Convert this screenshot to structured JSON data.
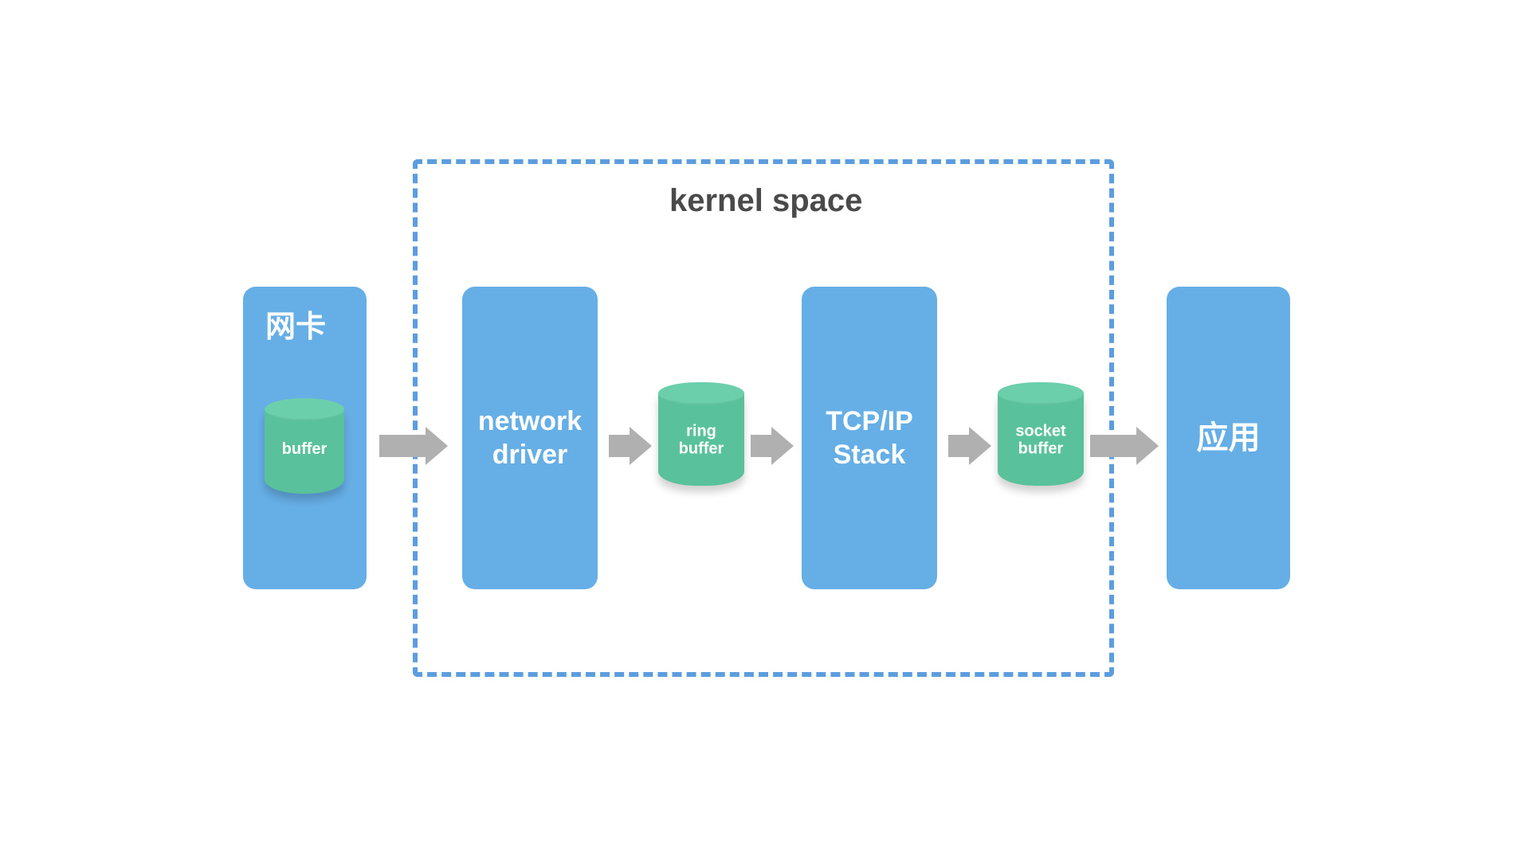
{
  "kernel_space_title": "kernel space",
  "nic": {
    "title": "网卡",
    "buffer_label": "buffer"
  },
  "network_driver": {
    "line1": "network",
    "line2": "driver"
  },
  "ring_buffer": {
    "line1": "ring",
    "line2": "buffer"
  },
  "tcpip_stack": {
    "line1": "TCP/IP",
    "line2": "Stack"
  },
  "socket_buffer": {
    "line1": "socket",
    "line2": "buffer"
  },
  "app": {
    "label": "应用"
  },
  "colors": {
    "box_blue": "#66aee6",
    "border_blue": "#5c9de0",
    "cylinder_green": "#59c29c",
    "arrow_grey": "#b0b0b0"
  }
}
